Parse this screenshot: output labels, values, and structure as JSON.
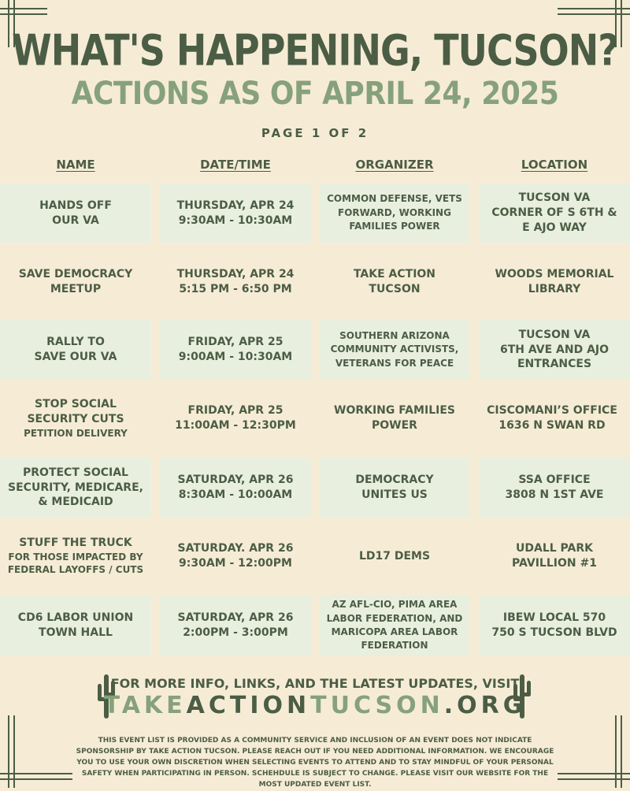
{
  "header": {
    "title": "WHAT'S HAPPENING, TUCSON?",
    "subtitle": "ACTIONS AS OF APRIL 24, 2025",
    "page_indicator": "PAGE 1 OF 2"
  },
  "columns": [
    "NAME",
    "DATE/TIME",
    "ORGANIZER",
    "LOCATION"
  ],
  "events": [
    {
      "name": [
        "HANDS OFF",
        "OUR VA"
      ],
      "date": [
        "THURSDAY, APR 24",
        "9:30AM - 10:30AM"
      ],
      "organizer": [
        "COMMON DEFENSE, VETS",
        "FORWARD, WORKING",
        "FAMILIES POWER"
      ],
      "location": [
        "TUCSON VA",
        "CORNER OF S 6TH &",
        "E AJO WAY"
      ]
    },
    {
      "name": [
        "SAVE DEMOCRACY",
        "MEETUP"
      ],
      "date": [
        "THURSDAY, APR 24",
        "5:15 PM - 6:50 PM"
      ],
      "organizer": [
        "TAKE ACTION",
        "TUCSON"
      ],
      "location": [
        "WOODS MEMORIAL",
        "LIBRARY"
      ]
    },
    {
      "name": [
        "RALLY TO",
        "SAVE OUR VA"
      ],
      "date": [
        "FRIDAY, APR 25",
        "9:00AM - 10:30AM"
      ],
      "organizer": [
        "SOUTHERN ARIZONA",
        "COMMUNITY ACTIVISTS,",
        "VETERANS FOR PEACE"
      ],
      "location": [
        "TUCSON VA",
        "6TH AVE AND AJO",
        "ENTRANCES"
      ]
    },
    {
      "name": [
        "STOP SOCIAL",
        "SECURITY CUTS"
      ],
      "name_small": "PETITION DELIVERY",
      "date": [
        "FRIDAY, APR 25",
        "11:00AM - 12:30PM"
      ],
      "organizer": [
        "WORKING FAMILIES",
        "POWER"
      ],
      "location": [
        "CISCOMANI’S OFFICE",
        "1636 N SWAN RD"
      ]
    },
    {
      "name": [
        "PROTECT SOCIAL",
        "SECURITY, MEDICARE,",
        "& MEDICAID"
      ],
      "date": [
        "SATURDAY, APR 26",
        "8:30AM - 10:00AM"
      ],
      "organizer": [
        "DEMOCRACY",
        "UNITES US"
      ],
      "location": [
        "SSA OFFICE",
        "3808 N 1ST AVE"
      ]
    },
    {
      "name": [
        "STUFF THE TRUCK"
      ],
      "name_small": [
        "FOR THOSE IMPACTED BY",
        "FEDERAL LAYOFFS / CUTS"
      ],
      "date": [
        "SATURDAY. APR 26",
        "9:30AM - 12:00PM"
      ],
      "organizer": [
        "LD17 DEMS"
      ],
      "location": [
        "UDALL PARK",
        "PAVILLION #1"
      ]
    },
    {
      "name": [
        "CD6 LABOR UNION",
        "TOWN HALL"
      ],
      "date": [
        "SATURDAY, APR 26",
        "2:00PM - 3:00PM"
      ],
      "organizer": [
        "AZ AFL-CIO, PIMA AREA",
        "LABOR FEDERATION, AND",
        "MARICOPA AREA LABOR",
        "FEDERATION"
      ],
      "location": [
        "IBEW LOCAL 570",
        "750 S TUCSON BLVD"
      ]
    }
  ],
  "footer": {
    "visit_text": "FOR MORE INFO, LINKS, AND THE LATEST UPDATES, VISIT",
    "url_part1": "TAKE",
    "url_part2": "ACTION",
    "url_part3": "TUCSON",
    "url_part4": ".ORG",
    "disclaimer": "THIS EVENT LIST IS PROVIDED AS A COMMUNITY SERVICE AND INCLUSION OF AN EVENT DOES NOT INDICATE SPONSORSHIP BY TAKE ACTION TUCSON. PLEASE REACH OUT IF YOU NEED ADDITIONAL INFORMATION. WE ENCOURAGE YOU TO USE YOUR OWN DISCRETION WHEN SELECTING EVENTS TO ATTEND AND TO STAY MINDFUL OF YOUR PERSONAL SAFETY WHEN PARTICIPATING IN PERSON. SCHEHDULE IS SUBJECT TO CHANGE. PLEASE VISIT OUR WEBSITE FOR THE MOST UPDATED EVENT LIST."
  },
  "icons": [
    "cactus-icon",
    "cactus-icon"
  ],
  "colors": {
    "background": "#f6ecd6",
    "dark_green": "#4c5d45",
    "light_green": "#86a17b",
    "cell_shade": "#e9efdf"
  }
}
